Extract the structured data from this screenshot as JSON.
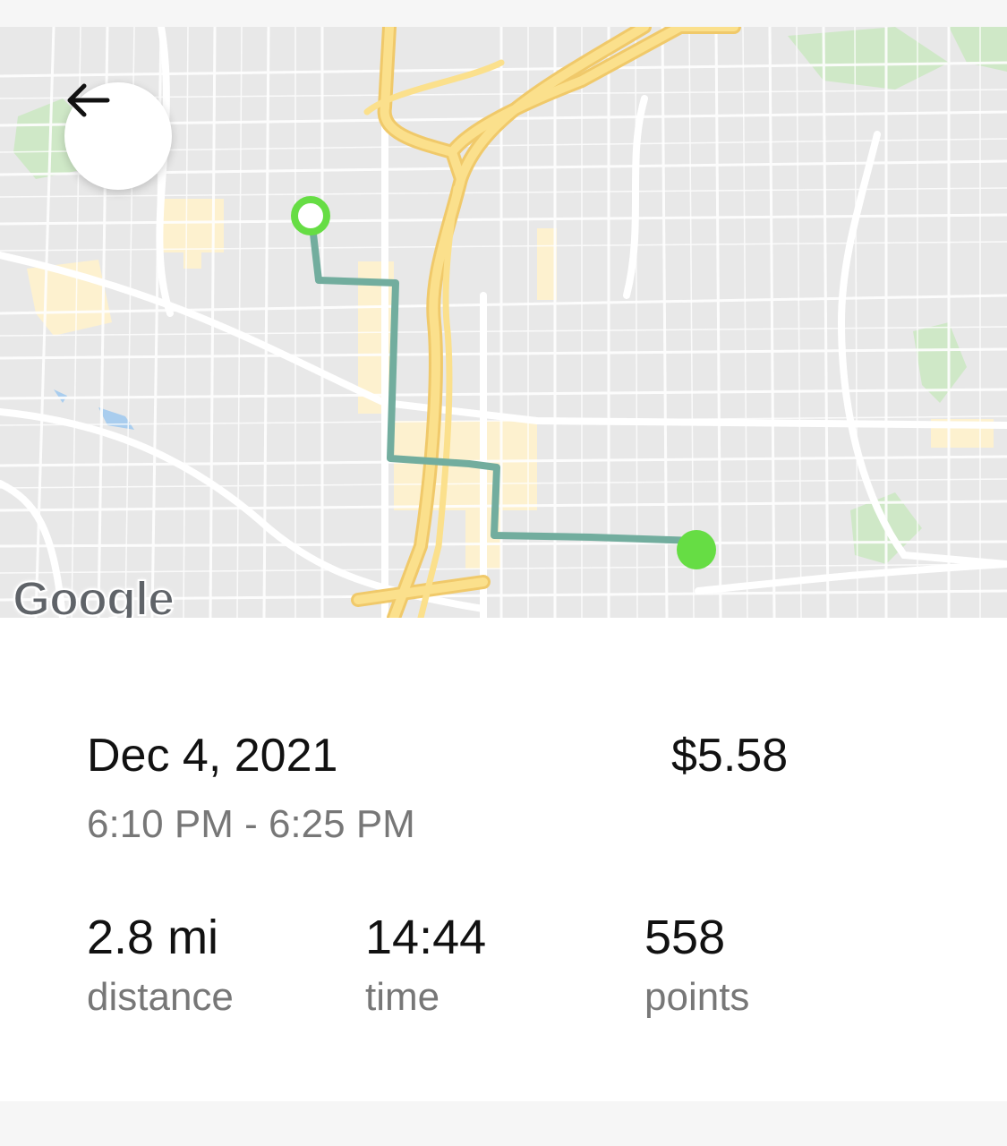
{
  "map": {
    "logo_text": "Google",
    "route_color": "#72ad9e",
    "start_marker_color": "#66dd44",
    "end_marker_color": "#66dd44",
    "highway_color": "#fbe08c",
    "icons": {
      "back": "arrow-left-icon",
      "start": "start-marker-icon",
      "end": "end-marker-icon"
    }
  },
  "trip": {
    "date": "Dec 4, 2021",
    "cost": "$5.58",
    "time_range": "6:10 PM - 6:25 PM"
  },
  "stats": [
    {
      "value": "2.8 mi",
      "label": "distance"
    },
    {
      "value": "14:44",
      "label": "time"
    },
    {
      "value": "558",
      "label": "points"
    }
  ]
}
